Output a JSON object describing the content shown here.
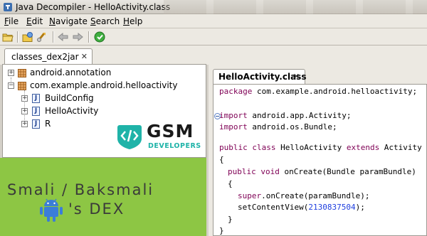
{
  "window": {
    "title": "Java Decompiler - HelloActivity.class"
  },
  "menu": [
    {
      "label": "File",
      "mnemonic": "F",
      "rest": "ile"
    },
    {
      "label": "Edit",
      "mnemonic": "E",
      "rest": "dit"
    },
    {
      "label": "Navigate",
      "mnemonic": "N",
      "rest": "avigate"
    },
    {
      "label": "Search",
      "mnemonic": "S",
      "rest": "earch"
    },
    {
      "label": "Help",
      "mnemonic": "H",
      "rest": "elp"
    }
  ],
  "toolbar": {
    "buttons": [
      "open-file-icon",
      "open-type-icon",
      "open-type-hierarchy-icon",
      "back-icon",
      "forward-icon",
      "web-icon"
    ]
  },
  "left_tab": {
    "label": "classes_dex2jar",
    "close": "✕"
  },
  "tree": [
    {
      "label": "android.annotation",
      "kind": "package"
    },
    {
      "label": "com.example.android.helloactivity",
      "kind": "package"
    },
    {
      "label": "BuildConfig",
      "kind": "class"
    },
    {
      "label": "HelloActivity",
      "kind": "class"
    },
    {
      "label": "R",
      "kind": "class"
    }
  ],
  "overlay": {
    "logo_main": "GSM",
    "logo_sub": "DEVELOPERS",
    "banner_line1": "Smali / Baksmali",
    "banner_line2": "'s DEX"
  },
  "editor_tab": {
    "label": "HelloActivity.class",
    "close": "✕"
  },
  "code": {
    "l1": "package com.example.android.helloactivity;",
    "l2_kw": "import",
    "l2": " android.app.Activity;",
    "l3_kw": "import",
    "l3": " android.os.Bundle;",
    "l4_kw1": "public class",
    "l4_mid": " HelloActivity ",
    "l4_kw2": "extends",
    "l4_end": " Activity",
    "l5": "{",
    "l6_kw": "public void",
    "l6": " onCreate(Bundle paramBundle)",
    "l7": "{",
    "l8_kw": "super",
    "l8": ".onCreate(paramBundle);",
    "l9_pre": "setContentView(",
    "l9_num": "2130837504",
    "l9_post": ");",
    "l10": "}",
    "l11": "}"
  },
  "colors": {
    "banner_green": "#8dc644",
    "keyword": "#7f0055",
    "number": "#1f3fdf",
    "logo_teal": "#1fb3a8"
  }
}
